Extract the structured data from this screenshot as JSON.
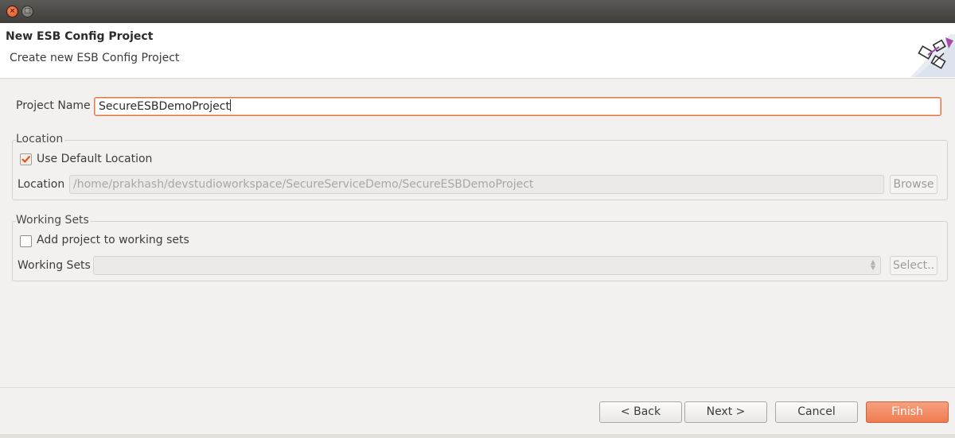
{
  "window": {
    "close_icon": "close-icon",
    "maximize_icon": "maximize-icon"
  },
  "header": {
    "title": "New ESB Config Project",
    "description": "Create new ESB Config Project"
  },
  "project_name": {
    "label": "Project Name",
    "value": "SecureESBDemoProject"
  },
  "location_group": {
    "title": "Location",
    "use_default_label": "Use Default Location",
    "use_default_checked": true,
    "location_label": "Location",
    "location_value": "/home/prakhash/devstudioworkspace/SecureServiceDemo/SecureESBDemoProject",
    "browse_label": "Browse"
  },
  "working_sets_group": {
    "title": "Working Sets",
    "add_label": "Add project to working sets",
    "add_checked": false,
    "working_sets_label": "Working Sets",
    "working_sets_value": "",
    "select_label": "Select.."
  },
  "buttons": {
    "back": "< Back",
    "next": "Next >",
    "cancel": "Cancel",
    "finish": "Finish"
  },
  "colors": {
    "accent": "#ef7c52",
    "focus_border": "#e0784a",
    "titlebar": "#3f3e3a",
    "background": "#f2f1f0"
  }
}
